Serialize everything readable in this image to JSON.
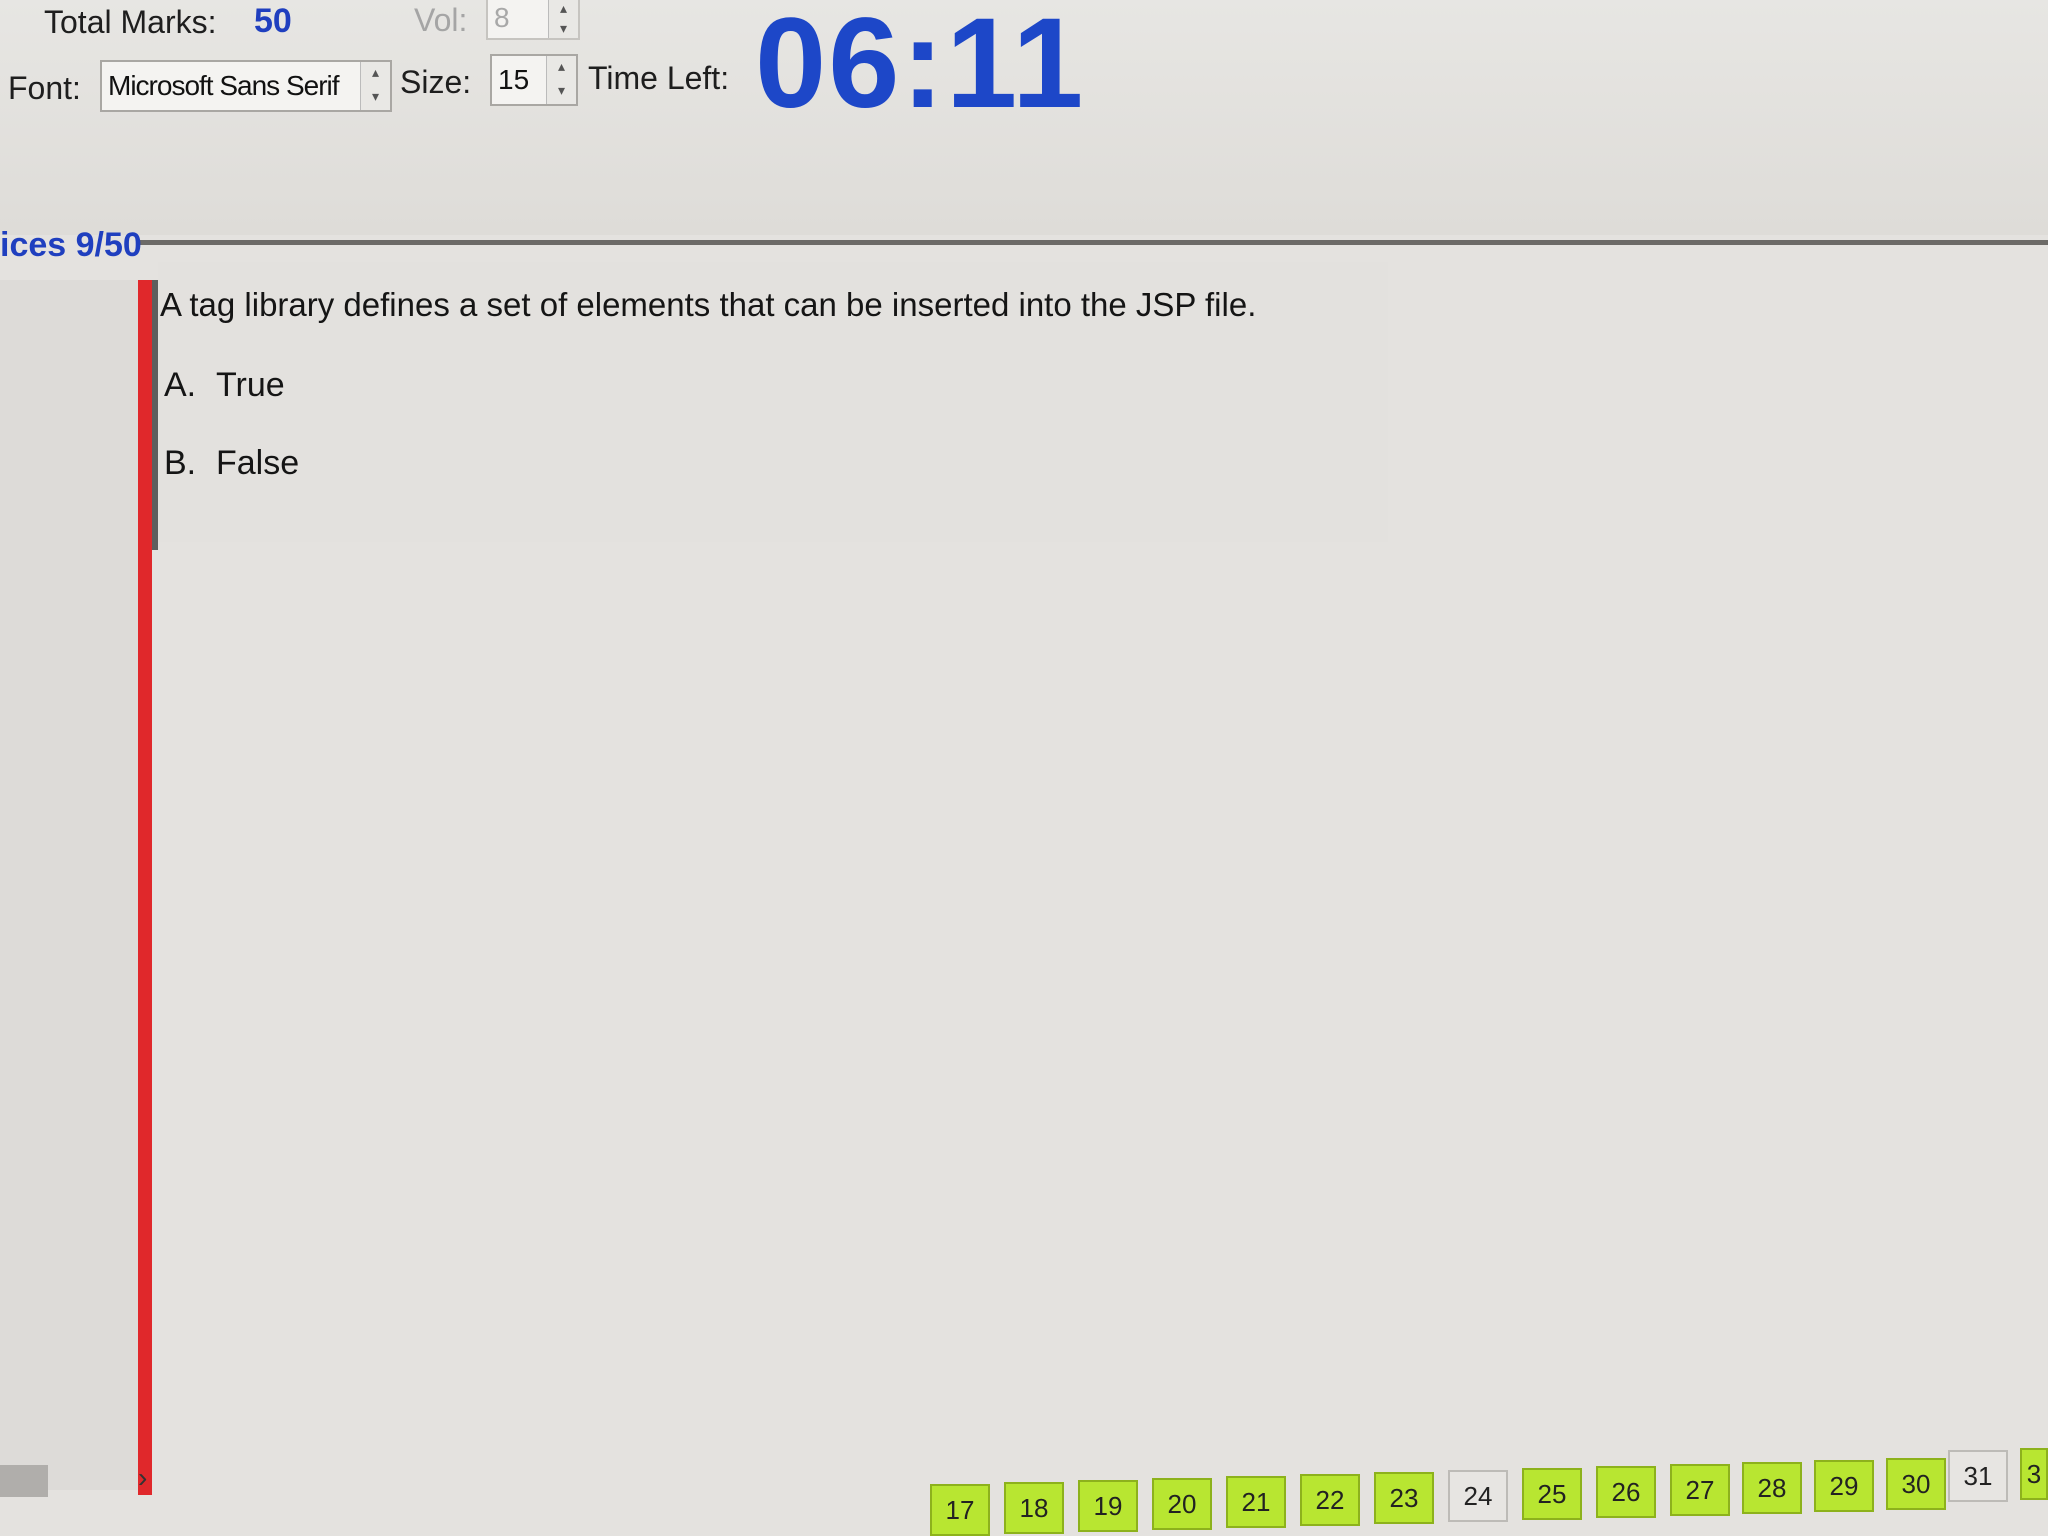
{
  "header": {
    "total_marks_label": "Total Marks:",
    "total_marks_value": "50",
    "vol_label": "Vol:",
    "vol_value": "8",
    "font_label": "Font:",
    "font_value": "Microsoft Sans Serif",
    "size_label": "Size:",
    "size_value": "15",
    "time_left_label": "Time Left:",
    "time_left_value": "06:11"
  },
  "question": {
    "counter": "ices 9/50",
    "text": "A tag library defines a set of elements that can be inserted into the JSP file.",
    "options": [
      {
        "letter": "A.",
        "label": "True"
      },
      {
        "letter": "B.",
        "label": "False"
      }
    ]
  },
  "navigation": {
    "scroll_arrow": "›",
    "question_buttons": [
      {
        "label": "17",
        "state": "answered"
      },
      {
        "label": "18",
        "state": "answered"
      },
      {
        "label": "19",
        "state": "answered"
      },
      {
        "label": "20",
        "state": "answered"
      },
      {
        "label": "21",
        "state": "answered"
      },
      {
        "label": "22",
        "state": "answered"
      },
      {
        "label": "23",
        "state": "answered"
      },
      {
        "label": "24",
        "state": "unanswered"
      },
      {
        "label": "25",
        "state": "answered"
      },
      {
        "label": "26",
        "state": "answered"
      },
      {
        "label": "27",
        "state": "answered"
      },
      {
        "label": "28",
        "state": "answered"
      },
      {
        "label": "29",
        "state": "answered"
      },
      {
        "label": "30",
        "state": "answered"
      },
      {
        "label": "31",
        "state": "unanswered"
      },
      {
        "label": "3",
        "state": "answered"
      }
    ]
  },
  "colors": {
    "accent_blue": "#1d47c8",
    "flag_red": "#e0282b",
    "answered_green": "#b8e631"
  }
}
